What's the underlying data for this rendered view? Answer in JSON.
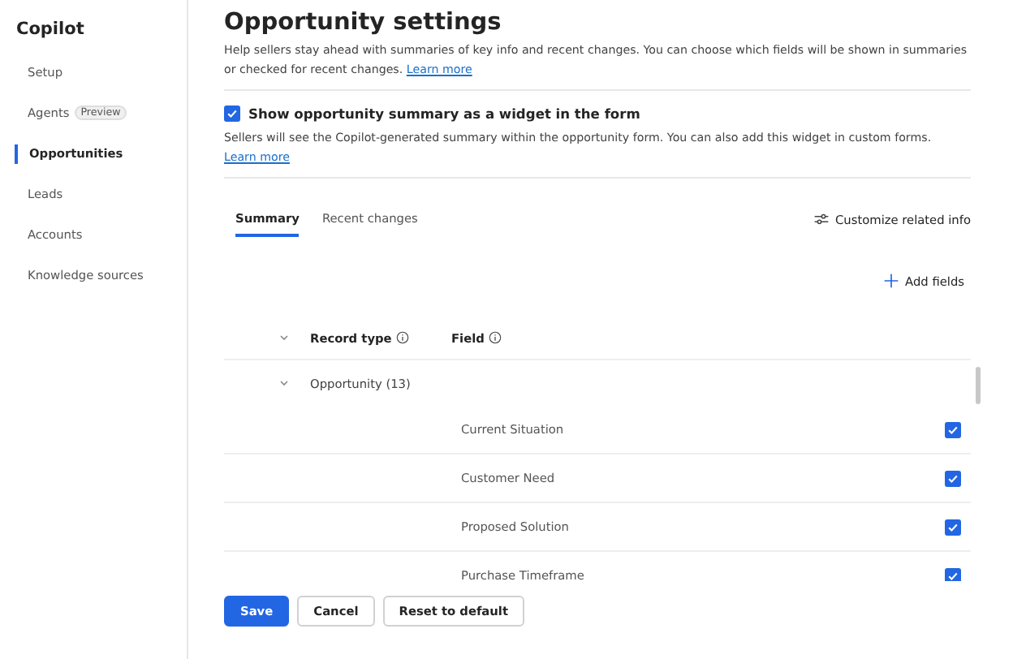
{
  "sidebar": {
    "title": "Copilot",
    "items": [
      {
        "label": "Setup",
        "selected": false
      },
      {
        "label": "Agents",
        "badge": "Preview",
        "selected": false
      },
      {
        "label": "Opportunities",
        "selected": true
      },
      {
        "label": "Leads",
        "selected": false
      },
      {
        "label": "Accounts",
        "selected": false
      },
      {
        "label": "Knowledge sources",
        "selected": false
      }
    ]
  },
  "page": {
    "title": "Opportunity settings",
    "description": "Help sellers stay ahead with summaries of key info and recent changes. You can choose which fields will be shown in summaries or checked for recent changes.",
    "description_link": "Learn more"
  },
  "widget_option": {
    "label": "Show opportunity summary as a widget in the form",
    "checked": true,
    "description": "Sellers will see the Copilot-generated summary within the opportunity form. You can also add this widget in custom forms.",
    "description_link": "Learn more"
  },
  "tabs": [
    {
      "label": "Summary",
      "selected": true
    },
    {
      "label": "Recent changes",
      "selected": false
    }
  ],
  "customize_button": "Customize related info",
  "add_fields_button": "Add fields",
  "table": {
    "columns": [
      "Record type",
      "Field"
    ],
    "group": {
      "label": "Opportunity (13)",
      "expanded": true
    },
    "rows": [
      {
        "field": "Current Situation",
        "checked": true
      },
      {
        "field": "Customer Need",
        "checked": true
      },
      {
        "field": "Proposed Solution",
        "checked": true
      },
      {
        "field": "Purchase Timeframe",
        "checked": true
      }
    ]
  },
  "buttons": [
    "Save",
    "Cancel",
    "Reset to default"
  ]
}
